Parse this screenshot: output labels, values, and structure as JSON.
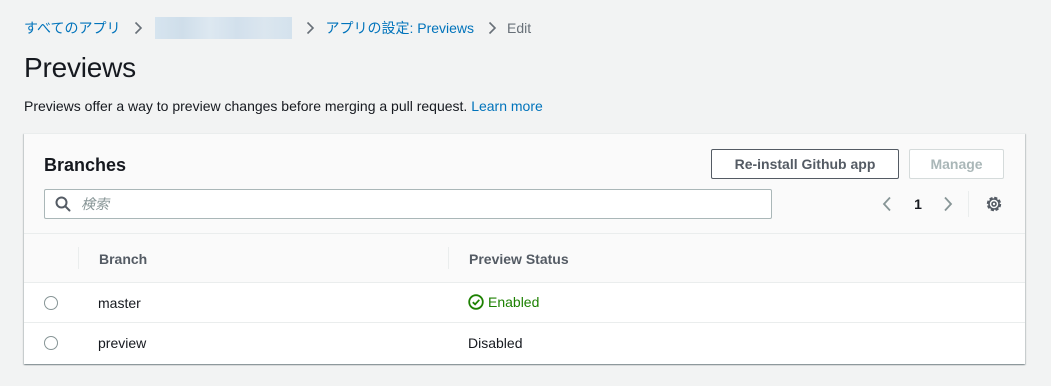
{
  "breadcrumb": {
    "all_apps": "すべてのアプリ",
    "app_settings": "アプリの設定: Previews",
    "current": "Edit"
  },
  "page": {
    "title": "Previews",
    "description": "Previews offer a way to preview changes before merging a pull request.",
    "learn_more": "Learn more"
  },
  "panel": {
    "title": "Branches",
    "reinstall_label": "Re-install Github app",
    "manage_label": "Manage",
    "search_placeholder": "検索",
    "page_number": "1",
    "columns": {
      "branch": "Branch",
      "preview_status": "Preview Status"
    },
    "rows": [
      {
        "branch": "master",
        "status": "Enabled"
      },
      {
        "branch": "preview",
        "status": "Disabled"
      }
    ]
  },
  "colors": {
    "link": "#0073bb",
    "enabled": "#1d8102",
    "disabled_button_text": "#aab7b8"
  },
  "icons": [
    "chevron-right-icon",
    "search-icon",
    "chevron-left-icon",
    "gear-icon",
    "check-circle-icon"
  ]
}
